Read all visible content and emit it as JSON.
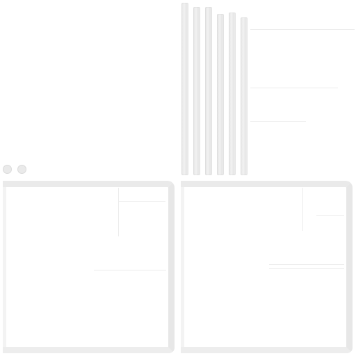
{
  "sheet": {
    "background_color": "#ffffff",
    "element_color": "#e8e8e8",
    "strip_count": 6
  },
  "regions": {
    "strips": [
      "strip-1",
      "strip-2",
      "strip-3",
      "strip-4",
      "strip-5",
      "strip-6"
    ],
    "dots": [
      "dot-1",
      "dot-2"
    ],
    "panels": [
      "panel-left",
      "panel-right"
    ]
  }
}
